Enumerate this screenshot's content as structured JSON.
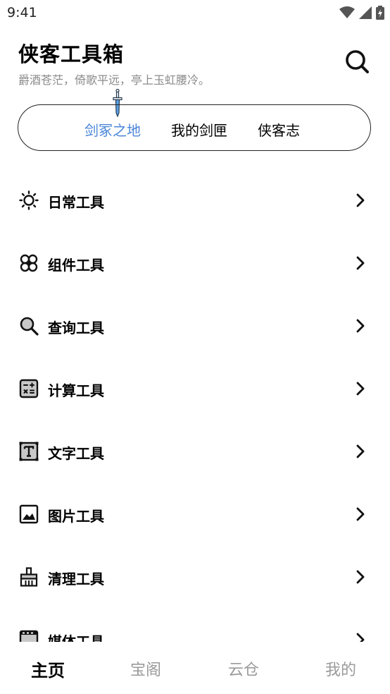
{
  "status": {
    "time": "9:41"
  },
  "header": {
    "title": "侠客工具箱",
    "subtitle": "爵酒苍茫，倚歌平远，亭上玉虹腰冷。"
  },
  "tabs": [
    {
      "label": "剑冢之地",
      "active": true
    },
    {
      "label": "我的剑匣",
      "active": false
    },
    {
      "label": "侠客志",
      "active": false
    }
  ],
  "menu": [
    {
      "label": "日常工具",
      "icon": "sun-icon"
    },
    {
      "label": "组件工具",
      "icon": "widget-icon"
    },
    {
      "label": "查询工具",
      "icon": "magnifier-icon"
    },
    {
      "label": "计算工具",
      "icon": "calculator-icon"
    },
    {
      "label": "文字工具",
      "icon": "text-icon"
    },
    {
      "label": "图片工具",
      "icon": "image-icon"
    },
    {
      "label": "清理工具",
      "icon": "broom-icon"
    },
    {
      "label": "媒体工具",
      "icon": "film-icon"
    }
  ],
  "bottom_nav": [
    {
      "label": "主页",
      "active": true
    },
    {
      "label": "宝阁",
      "active": false
    },
    {
      "label": "云仓",
      "active": false
    },
    {
      "label": "我的",
      "active": false
    }
  ],
  "colors": {
    "accent": "#4a86d8",
    "muted": "#9a9a9a"
  }
}
